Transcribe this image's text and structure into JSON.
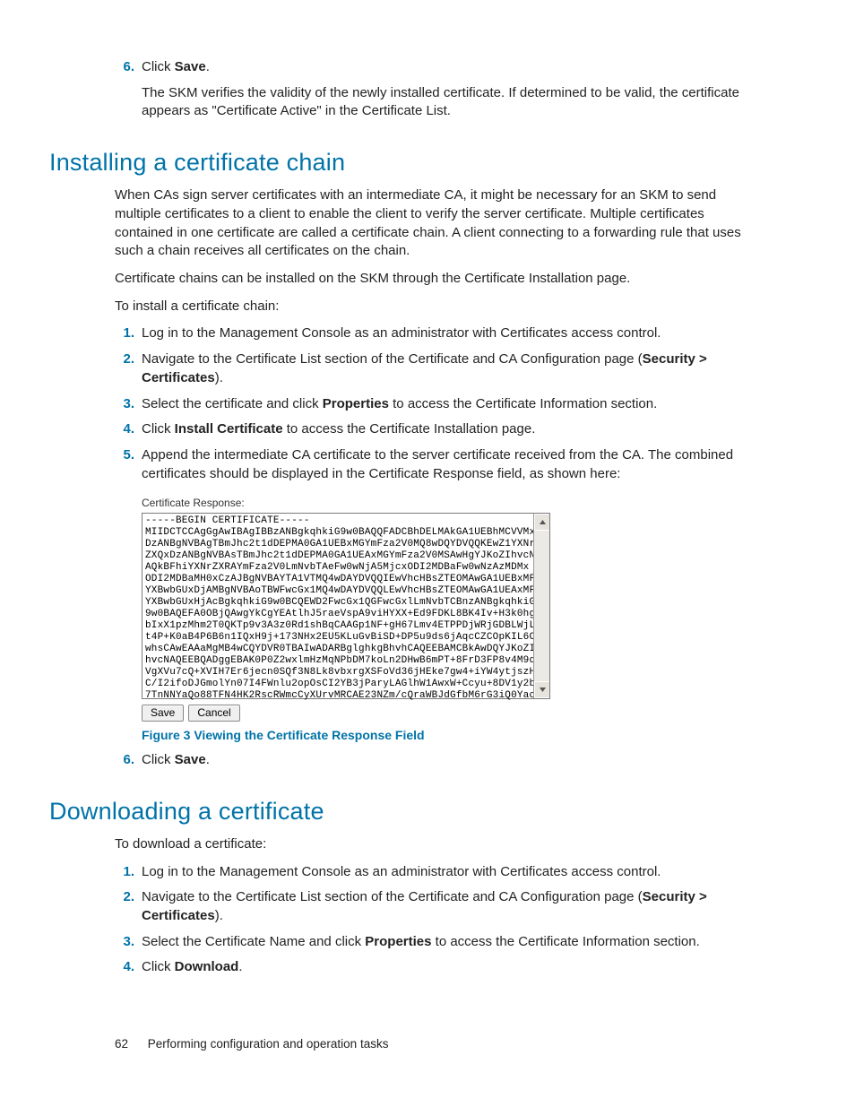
{
  "step6a": {
    "num": "6.",
    "lead": "Click ",
    "bold": "Save",
    "tail": ".",
    "desc": "The SKM verifies the validity of the newly installed certificate. If determined to be valid, the certificate appears as \"Certificate Active\" in the Certificate List."
  },
  "sect1": {
    "title": "Installing a certificate chain",
    "p1": "When CAs sign server certificates with an intermediate CA, it might be necessary for an SKM to send multiple certificates to a client to enable the client to verify the server certificate. Multiple certificates contained in one certificate are called a certificate chain. A client connecting to a forwarding rule that uses such a chain receives all certificates on the chain.",
    "p2": "Certificate chains can be installed on the SKM through the Certificate Installation page.",
    "p3": "To install a certificate chain:",
    "steps": [
      {
        "num": "1.",
        "plain": "Log in to the Management Console as an administrator with Certificates access control."
      },
      {
        "num": "2.",
        "pre": "Navigate to the Certificate List section of the Certificate and CA Configuration page (",
        "b": "Security > Certificates",
        "post": ")."
      },
      {
        "num": "3.",
        "pre": "Select the certificate and click ",
        "b": "Properties",
        "post": " to access the Certificate Information section."
      },
      {
        "num": "4.",
        "pre": "Click ",
        "b": "Install Certificate",
        "post": " to access the Certificate Installation page."
      },
      {
        "num": "5.",
        "plain": "Append the intermediate CA certificate to the server certificate received from the CA. The combined certificates should be displayed in the Certificate Response field, as shown here:"
      }
    ],
    "figlabel": "Certificate Response:",
    "cert": "-----BEGIN CERTIFICATE-----\nMIIDCTCCAgGgAwIBAgIBBzANBgkqhkiG9w0BAQQFADCBhDELMAkGA1UEBhMCVVMx\nDzANBgNVBAgTBmJhc2t1dDEPMA0GA1UEBxMGYmFza2V0MQ8wDQYDVQQKEwZ1YXNr\nZXQxDzANBgNVBAsTBmJhc2t1dDEPMA0GA1UEAxMGYmFza2V0MSAwHgYJKoZIhvcN\nAQkBFhiYXNrZXRAYmFza2V0LmNvbTAeFw0wNjA5MjcxODI2MDBaFw0wNzAzMDMx\nODI2MDBaMH0xCzAJBgNVBAYTA1VTMQ4wDAYDVQQIEwVhcHBsZTEOMAwGA1UEBxMF\nYXBwbGUxDjAMBgNVBAoTBWFwcGx1MQ4wDAYDVQQLEwVhcHBsZTEOMAwGA1UEAxMF\nYXBwbGUxHjAcBgkqhkiG9w0BCQEWD2FwcGx1QGFwcGxlLmNvbTCBnzANBgkqhkiG\n9w0BAQEFA0OBjQAwgYkCgYEAtlhJ5raeVspA9viHYXX+Ed9FDKL8BK4Iv+H3k0hg\nbIxX1pzMhm2T0QKTp9v3A3z0Rd1shBqCAAGp1NF+gH67Lmv4ETPPDjWRjGDBLWjL\nt4P+K0aB4P6B6n1IQxH9j+173NHx2EU5KLuGvBiSD+DP5u9ds6jAqcCZCOpKIL6C\nwhsCAwEAAaMgMB4wCQYDVR0TBAIwADARBglghkgBhvhCAQEEBAMCBkAwDQYJKoZI\nhvcNAQEEBQADggEBAK0P0Z2wxlmHzMqNPbDM7koLn2DHwB6mPT+8FrD3FP8v4M9q\nVgXVu7cQ+XVIH7Er6jecn0SQf3N8Lk8vbxrgXSFoVd36jHEke7gw4+iYW4ytjszH\nC/I2ifoDJGmolYn07I4FWnlu2opOsCI2YB3jParyLAGlhW1AwxW+Ccyu+8DV1y2b\n7TnNNYaQo88TFN4HK2RscRWmcCyXUrvMRCAE23NZm/cQraWBJdGfbM6rG3iQ0Yac",
    "figcaption": "Figure 3 Viewing the Certificate Response Field",
    "save": "Save",
    "cancel": "Cancel",
    "step6": {
      "num": "6.",
      "pre": "Click ",
      "b": "Save",
      "post": "."
    }
  },
  "sect2": {
    "title": "Downloading a certificate",
    "p1": "To download a certificate:",
    "steps": [
      {
        "num": "1.",
        "plain": "Log in to the Management Console as an administrator with Certificates access control."
      },
      {
        "num": "2.",
        "pre": "Navigate to the Certificate List section of the Certificate and CA Configuration page (",
        "b": "Security > Certificates",
        "post": ")."
      },
      {
        "num": "3.",
        "pre": "Select the Certificate Name and click ",
        "b": "Properties",
        "post": " to access the Certificate Information section."
      },
      {
        "num": "4.",
        "pre": "Click ",
        "b": "Download",
        "post": "."
      }
    ]
  },
  "footer": {
    "page": "62",
    "title": "Performing configuration and operation tasks"
  }
}
